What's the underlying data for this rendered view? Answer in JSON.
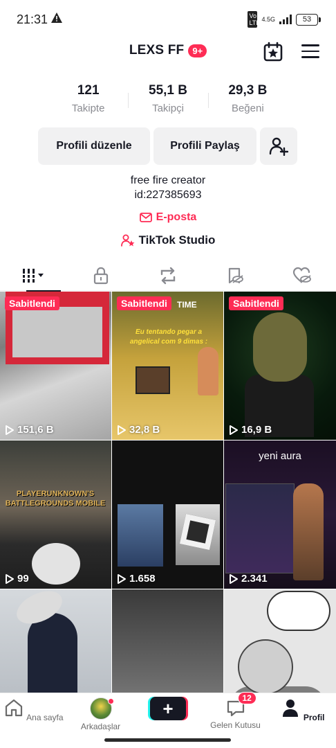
{
  "status_bar": {
    "time": "21:31",
    "network": "4.5G",
    "volte": "Vo LTE",
    "battery": "53"
  },
  "header": {
    "username": "LEXS FF",
    "notification_badge": "9+"
  },
  "stats": [
    {
      "value": "121",
      "label": "Takipte"
    },
    {
      "value": "55,1 B",
      "label": "Takipçi"
    },
    {
      "value": "29,3 B",
      "label": "Beğeni"
    }
  ],
  "actions": {
    "edit_profile": "Profili düzenle",
    "share_profile": "Profili Paylaş"
  },
  "bio": {
    "line1": "free fire creator",
    "line2": "id:227385693",
    "email": "E-posta",
    "studio": "TikTok Studio"
  },
  "tabs": [
    {
      "name": "videos",
      "icon": "grid-bars-icon"
    },
    {
      "name": "private",
      "icon": "lock-icon"
    },
    {
      "name": "reposts",
      "icon": "repost-icon"
    },
    {
      "name": "favorites",
      "icon": "bookmark-hidden-icon"
    },
    {
      "name": "liked",
      "icon": "heart-hidden-icon"
    }
  ],
  "grid": {
    "pinned_label": "Sabitlendi",
    "videos": [
      {
        "views": "151,6 B",
        "pinned": true
      },
      {
        "views": "32,8 B",
        "pinned": true,
        "overlay_title": "TIME",
        "overlay_text": "Eu tentando pegar a angelical com 9 dimas :"
      },
      {
        "views": "16,9 B",
        "pinned": true
      },
      {
        "views": "99",
        "pinned": false,
        "overlay_text": "PLAYERUNKNOWN'S BATTLEGROUNDS MOBILE"
      },
      {
        "views": "1.658",
        "pinned": false
      },
      {
        "views": "2.341",
        "pinned": false,
        "caption": "yeni aura"
      },
      {
        "views": "",
        "pinned": false
      },
      {
        "views": "",
        "pinned": false
      },
      {
        "views": "",
        "pinned": false
      }
    ]
  },
  "bottom_nav": {
    "home": "Ana sayfa",
    "friends": "Arkadaşlar",
    "inbox": "Gelen Kutusu",
    "inbox_badge": "12",
    "profile": "Profil"
  },
  "colors": {
    "accent": "#fe2c55",
    "text": "#161823",
    "muted": "#8a8b91"
  }
}
